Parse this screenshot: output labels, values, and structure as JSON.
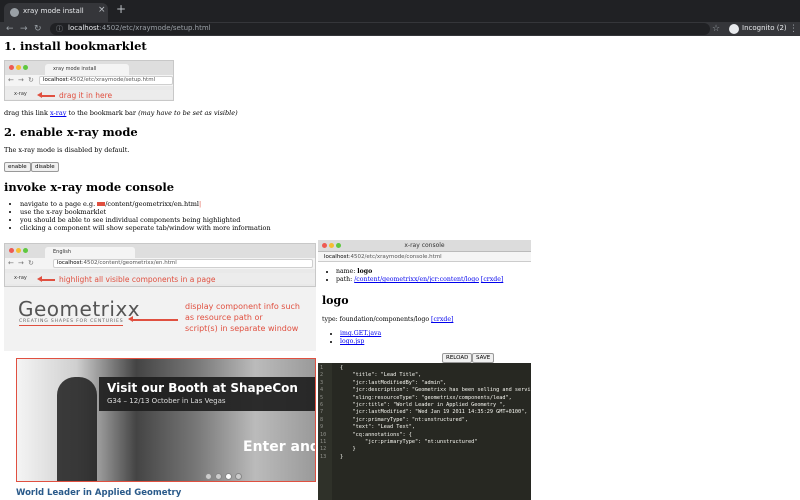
{
  "browser": {
    "tab_title": "xray mode install",
    "close_glyph": "×",
    "new_tab_glyph": "+",
    "back_glyph": "←",
    "forward_glyph": "→",
    "reload_glyph": "↻",
    "info_glyph": "ⓘ",
    "url_host": "localhost",
    "url_path": ":4502/etc/xraymode/setup.html",
    "star_glyph": "☆",
    "incognito_label": "Incognito (2)",
    "menu_glyph": "⋮"
  },
  "section1": {
    "heading": "1. install bookmarklet",
    "mini_tab": "xray mode install",
    "mini_url_host": "localhost",
    "mini_url_path": ":4502/etc/xraymode/setup.html",
    "mini_bookmark": "x-ray",
    "drag_hint": "drag it in here",
    "desc_before": "drag this link ",
    "desc_link": "x-ray",
    "desc_after": " to the bookmark bar ",
    "desc_note": "(may have to be set as visible)"
  },
  "section2": {
    "heading": "2. enable x-ray mode",
    "desc": "The x-ray mode is disabled by default.",
    "enable_label": "enable",
    "disable_label": "disable"
  },
  "section3": {
    "heading": "invoke x-ray mode console",
    "bullets": [
      "navigate to a page e.g. ",
      "use the x-ray bookmarklet",
      "you should be able to see individual components being highlighted",
      "clicking a component will show seperate tab/window with more information"
    ],
    "bullet1_path": "/content/geometrixx/en.html"
  },
  "demo": {
    "tab": "English",
    "url_host": "localhost",
    "url_path": ":4502/content/geometrixx/en.html",
    "bookmark": "x-ray",
    "highlight_hint": "highlight all visible components in a page",
    "logo": "Geometrixx",
    "tagline": "CREATING SHAPES FOR CENTURIES",
    "info_lines": [
      "display component info such",
      "as resource path or",
      "script(s) in separate window"
    ],
    "banner_heading": "Visit our Booth at ShapeCon",
    "banner_sub": "G34 – 12/13 October in Las Vegas",
    "banner_enter": "Enter and",
    "world_leader": "World Leader in Applied Geometry"
  },
  "console": {
    "title": "x-ray console",
    "url_host": "localhost",
    "url_path": ":4502/etc/xraymode/console.html",
    "name_label": "name: ",
    "name_value": "logo",
    "path_label": "path: ",
    "path_value": "/content/geometrixx/en/jcr:content/logo",
    "crxde": "[crxde]",
    "heading": "logo",
    "type_label": "type: foundation/components/logo ",
    "files": [
      "img.GET.java",
      "logo.jsp"
    ],
    "reload_label": "RELOAD",
    "save_label": "SAVE",
    "code_lines": [
      "{",
      "    \"title\": \"Lead Title\",",
      "    \"jcr:lastModifiedBy\": \"admin\",",
      "    \"jcr:description\": \"Geometrixx has been selling and servi",
      "    \"sling:resourceType\": \"geometrixx/components/lead\",",
      "    \"jcr:title\": \"World Leader in Applied Geometry \",",
      "    \"jcr:lastModified\": \"Wed Jan 19 2011 14:35:29 GMT+0100\",",
      "    \"jcr:primaryType\": \"nt:unstructured\",",
      "    \"text\": \"Lead Text\",",
      "    \"cq:annotations\": {",
      "        \"jcr:primaryType\": \"nt:unstructured\"",
      "    }",
      "}"
    ],
    "line_numbers": [
      "1",
      "2",
      "3",
      "4",
      "5",
      "6",
      "7",
      "8",
      "9",
      "10",
      "11",
      "12",
      "13"
    ]
  },
  "colors": {
    "accent_red": "#e05040",
    "link_blue": "#0000ee",
    "code_bg": "#272822"
  }
}
